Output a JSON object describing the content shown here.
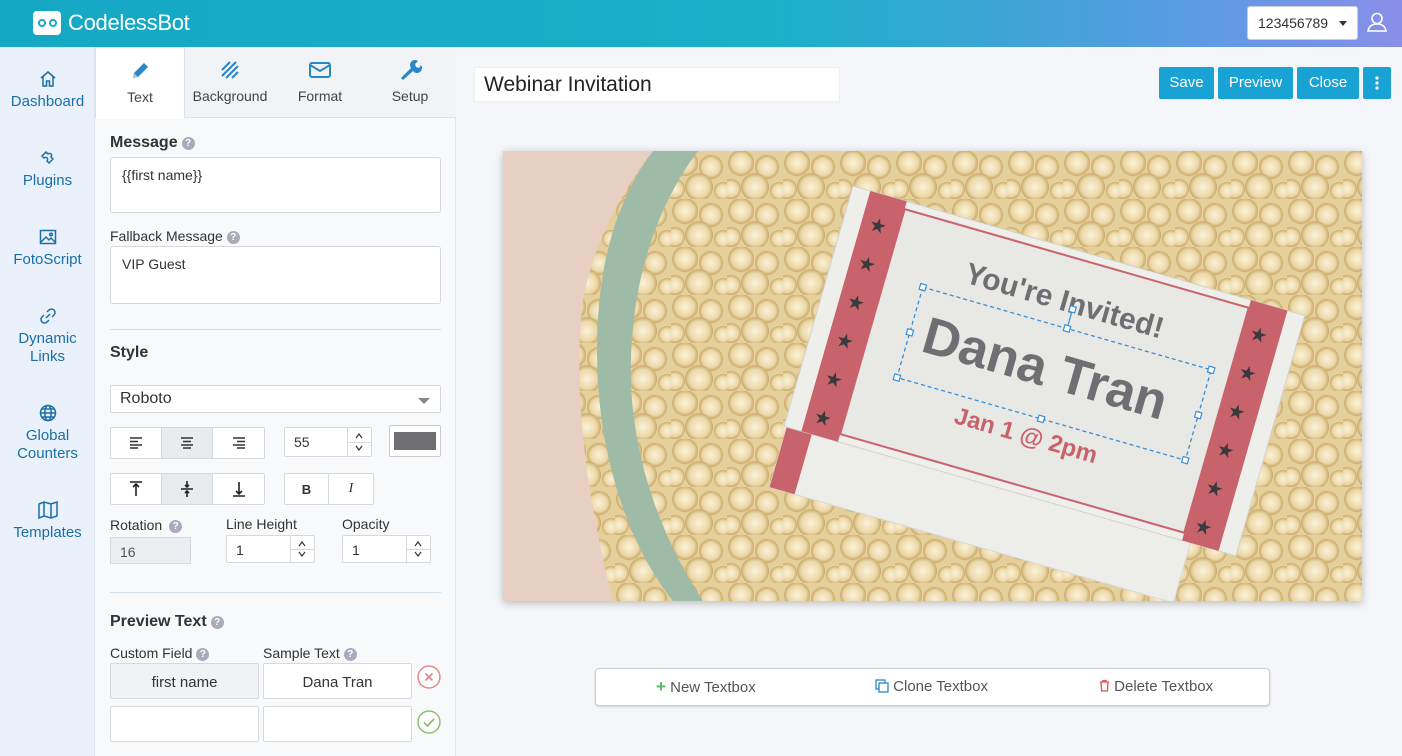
{
  "app": {
    "name": "CodelessBot"
  },
  "header": {
    "account": "123456789"
  },
  "nav": [
    {
      "label": "Dashboard",
      "icon": "home-icon"
    },
    {
      "label": "Plugins",
      "icon": "plugin-icon"
    },
    {
      "label": "FotoScript",
      "icon": "image-icon"
    },
    {
      "label": "Dynamic Links",
      "icon": "link-icon"
    },
    {
      "label": "Global Counters",
      "icon": "globe-icon"
    },
    {
      "label": "Templates",
      "icon": "map-icon"
    }
  ],
  "tabs": [
    {
      "label": "Text",
      "icon": "pencil-icon",
      "active": true
    },
    {
      "label": "Background",
      "icon": "stripes-icon"
    },
    {
      "label": "Format",
      "icon": "envelope-icon"
    },
    {
      "label": "Setup",
      "icon": "wrench-icon"
    }
  ],
  "text_tab": {
    "message_label": "Message",
    "message_value": "{{first name}}",
    "fallback_label": "Fallback Message",
    "fallback_value": "VIP Guest",
    "style_label": "Style",
    "font": "Roboto",
    "font_size": "55",
    "text_color": "#6f6f73",
    "rotation_label": "Rotation",
    "rotation_value": "16",
    "line_height_label": "Line Height",
    "line_height_value": "1",
    "opacity_label": "Opacity",
    "opacity_value": "1",
    "preview_label": "Preview Text",
    "custom_field_label": "Custom Field",
    "sample_text_label": "Sample Text",
    "rows": [
      {
        "field": "first name",
        "sample": "Dana Tran"
      },
      {
        "field": "",
        "sample": ""
      }
    ]
  },
  "editor": {
    "title": "Webinar Invitation",
    "save": "Save",
    "preview": "Preview",
    "close": "Close"
  },
  "canvas": {
    "headline": "You're Invited!",
    "name": "Dana Tran",
    "date": "Jan 1 @ 2pm"
  },
  "toolbar": {
    "new": "New Textbox",
    "clone": "Clone Textbox",
    "delete": "Delete Textbox"
  },
  "colors": {
    "accent": "#19a3d4",
    "ticket_red": "#c8636b",
    "nav_text": "#1a6fa6"
  }
}
